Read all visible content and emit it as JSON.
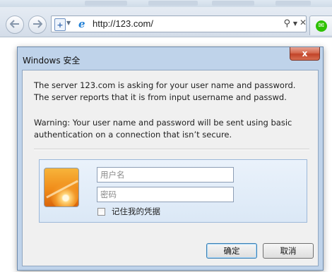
{
  "browser": {
    "url": "http://123.com/",
    "tab_icon": "wechat-icon",
    "tab_icon_glyph": "✉"
  },
  "dialog": {
    "title": "Windows 安全",
    "close_glyph": "x",
    "message_line1": "The server 123.com is asking for your user name and password.",
    "message_line2": "The server reports that it is from input username and passwd.",
    "warning_line1": "Warning: Your user name and password will be sent using basic",
    "warning_line2": "authentication on a connection that isn’t secure.",
    "username_placeholder": "用户名",
    "password_placeholder": "密码",
    "remember_label": "记住我的凭据",
    "remember_checked": false,
    "ok_label": "确定",
    "cancel_label": "取消"
  }
}
